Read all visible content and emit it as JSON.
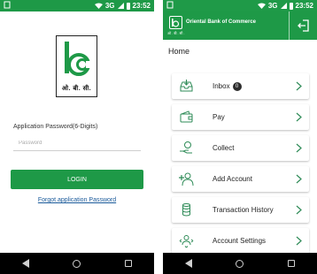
{
  "left_screen": {
    "status": {
      "time": "23:52",
      "network": "3G"
    },
    "logo": {
      "text": "ओ. बी. सी."
    },
    "password_label": "Application Password(6-Digits)",
    "password_placeholder": "Password",
    "login_label": "LOGIN",
    "forgot_label": "Forgot application Password"
  },
  "right_screen": {
    "status": {
      "time": "23:52",
      "network": "3G"
    },
    "appbar": {
      "bank_name": "Oriental Bank of Commerce",
      "logo_sub": "ओ.बी.सी."
    },
    "page_title": "Home",
    "menu": [
      {
        "label": "Inbox",
        "badge": "0",
        "icon": "inbox-icon"
      },
      {
        "label": "Pay",
        "icon": "wallet-icon"
      },
      {
        "label": "Collect",
        "icon": "collect-money-icon"
      },
      {
        "label": "Add Account",
        "icon": "add-user-icon"
      },
      {
        "label": "Transaction History",
        "icon": "coins-history-icon"
      },
      {
        "label": "Account Settings",
        "icon": "account-settings-icon"
      }
    ]
  },
  "colors": {
    "brand_green": "#1e9947",
    "link_blue": "#1a5a9a",
    "icon_green": "#2e8b57"
  }
}
